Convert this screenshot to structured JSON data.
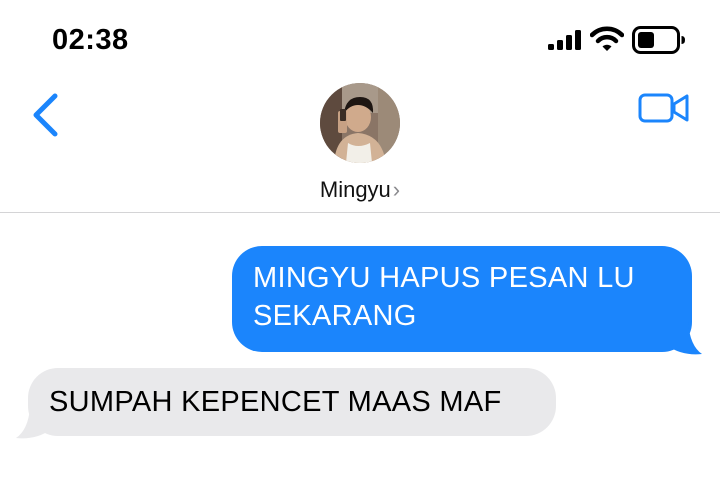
{
  "status_bar": {
    "time": "02:38",
    "icons": [
      "cellular-signal-icon",
      "wifi-icon",
      "battery-icon"
    ]
  },
  "header": {
    "contact_name": "Mingyu",
    "chevron": "›",
    "icons": [
      "chevron-left-icon",
      "video-camera-icon"
    ]
  },
  "messages": [
    {
      "direction": "sent",
      "lines": [
        "MINGYU HAPUS PESAN LU",
        "SEKARANG"
      ]
    },
    {
      "direction": "received",
      "lines": [
        "SUMPAH KEPENCET MAAS MAF"
      ]
    }
  ],
  "colors": {
    "accent": "#1b85fc",
    "sent_bubble": "#1b85fc",
    "received_bubble": "#e9e9eb",
    "divider": "#d4d4d6"
  }
}
